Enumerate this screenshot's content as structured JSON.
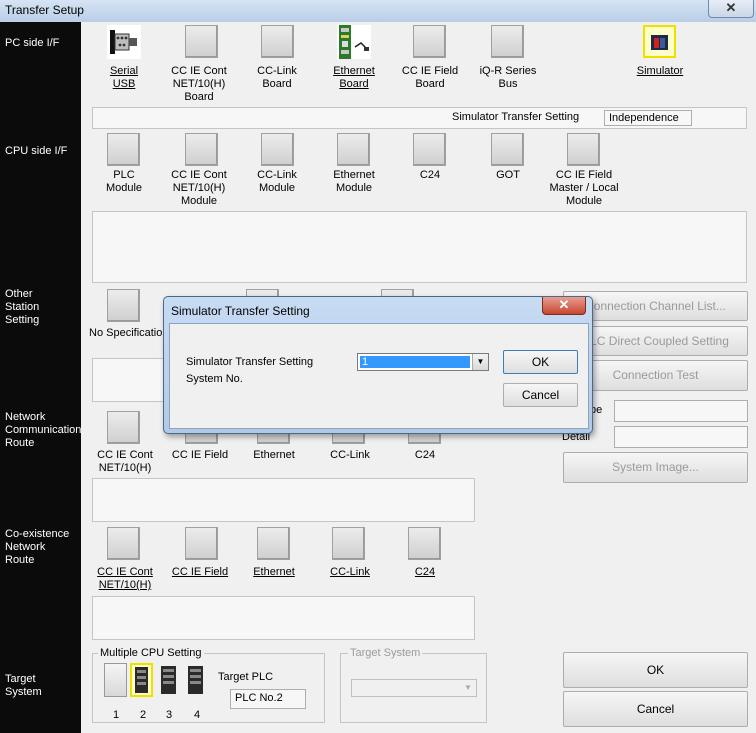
{
  "window": {
    "title": "Transfer Setup",
    "close": "✕"
  },
  "sections": {
    "pc_side": "PC side I/F",
    "cpu_side": "CPU side I/F",
    "other_station_1": "Other",
    "other_station_2": "Station",
    "other_station_3": "Setting",
    "network_route_1": "Network",
    "network_route_2": "Communication",
    "network_route_3": "Route",
    "coexist_1": "Co-existence",
    "coexist_2": "Network",
    "coexist_3": "Route",
    "target_1": "Target",
    "target_2": "System"
  },
  "pc_side_items": [
    {
      "l1": "Serial",
      "l2": "USB",
      "l3": ""
    },
    {
      "l1": "CC IE Cont",
      "l2": "NET/10(H)",
      "l3": "Board"
    },
    {
      "l1": "CC-Link",
      "l2": "Board",
      "l3": ""
    },
    {
      "l1": "Ethernet",
      "l2": "Board",
      "l3": ""
    },
    {
      "l1": "CC IE Field",
      "l2": "Board",
      "l3": ""
    },
    {
      "l1": "iQ-R Series",
      "l2": "Bus",
      "l3": ""
    },
    {
      "l1": "Simulator",
      "l2": "",
      "l3": ""
    }
  ],
  "sim_transfer": {
    "label": "Simulator Transfer Setting",
    "value": "Independence"
  },
  "cpu_side_items": [
    {
      "l1": "PLC",
      "l2": "Module",
      "l3": ""
    },
    {
      "l1": "CC IE Cont",
      "l2": "NET/10(H)",
      "l3": "Module"
    },
    {
      "l1": "CC-Link",
      "l2": "Module",
      "l3": ""
    },
    {
      "l1": "Ethernet",
      "l2": "Module",
      "l3": ""
    },
    {
      "l1": "C24",
      "l2": "",
      "l3": ""
    },
    {
      "l1": "GOT",
      "l2": "",
      "l3": ""
    },
    {
      "l1": "CC IE Field",
      "l2": "Master / Local",
      "l3": "Module"
    }
  ],
  "other_station": {
    "no_spec": "No Specification"
  },
  "right_buttons": {
    "connection_channel": "Connection Channel List...",
    "cpu_direct": "PLC Direct Coupled Setting",
    "connection_test": "Connection Test",
    "system_image": "System Image..."
  },
  "right_fields": {
    "type_label": "pe",
    "detail_label": "Detail"
  },
  "network_items": [
    {
      "l1": "CC IE Cont",
      "l2": "NET/10(H)"
    },
    {
      "l1": "CC IE Field",
      "l2": ""
    },
    {
      "l1": "Ethernet",
      "l2": ""
    },
    {
      "l1": "CC-Link",
      "l2": ""
    },
    {
      "l1": "C24",
      "l2": ""
    }
  ],
  "coexist_items": [
    {
      "l1": "CC IE Cont",
      "l2": "NET/10(H)"
    },
    {
      "l1": "CC IE Field",
      "l2": ""
    },
    {
      "l1": "Ethernet",
      "l2": ""
    },
    {
      "l1": "CC-Link",
      "l2": ""
    },
    {
      "l1": "C24",
      "l2": ""
    }
  ],
  "multi_cpu": {
    "title": "Multiple CPU Setting",
    "numbers": [
      "1",
      "2",
      "3",
      "4"
    ],
    "target_plc_label": "Target PLC",
    "target_plc_value": "PLC No.2"
  },
  "target_system": {
    "title": "Target System"
  },
  "ok": "OK",
  "cancel": "Cancel",
  "dialog": {
    "title": "Simulator Transfer Setting",
    "label1": "Simulator Transfer Setting",
    "label2": "System No.",
    "select_value": "1",
    "ok": "OK",
    "cancel": "Cancel",
    "close": "✕"
  }
}
